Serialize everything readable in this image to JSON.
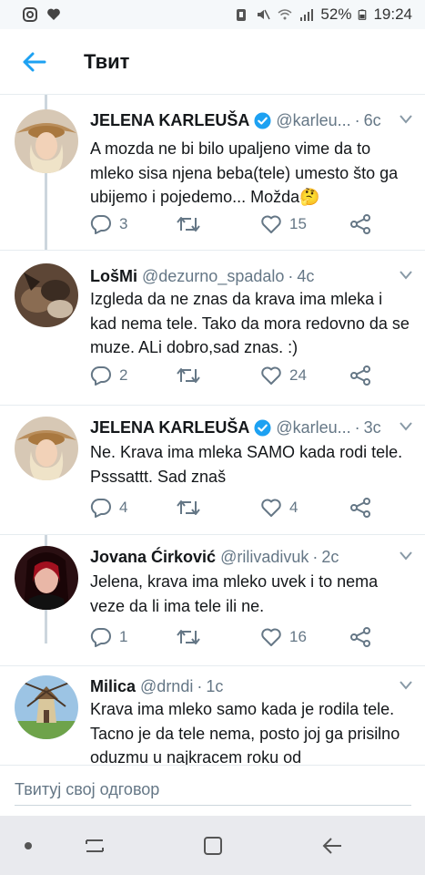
{
  "status_bar": {
    "left_icons": [
      "instagram-icon",
      "heart-icon"
    ],
    "battery": "52%",
    "time": "19:24"
  },
  "header": {
    "title": "Твит",
    "back_icon": "arrow-left-icon"
  },
  "tweets": [
    {
      "name": "JELENA KARLEUŠA",
      "verified": true,
      "handle": "@karleu...",
      "time": "6c",
      "text": "A mozda ne bi bilo upaljeno vime da to mleko sisa njena beba(tele) umesto što ga ubijemo i pojedemo... Možda🤔",
      "replies": "3",
      "retweets": "",
      "likes": "15"
    },
    {
      "name": "LošMi",
      "verified": false,
      "handle": "@dezurno_spadalo",
      "time": "4c",
      "text": "Izgleda da ne znas da krava ima mleka i kad nema tele. Tako da mora redovno da se muze. ALi dobro,sad znas. :)",
      "replies": "2",
      "retweets": "",
      "likes": "24"
    },
    {
      "name": "JELENA KARLEUŠA",
      "verified": true,
      "handle": "@karleu...",
      "time": "3c",
      "text": "Ne. Krava ima mleka SAMO kada rodi tele. Psssattt. Sad znaš",
      "replies": "4",
      "retweets": "",
      "likes": "4"
    },
    {
      "name": "Jovana Ćirković",
      "verified": false,
      "handle": "@rilivadivuk",
      "time": "2c",
      "text": "Jelena, krava ima mleko uvek i to nema veze da li ima tele ili ne.",
      "replies": "1",
      "retweets": "",
      "likes": "16"
    },
    {
      "name": "Milica",
      "verified": false,
      "handle": "@drndi",
      "time": "1c",
      "text": "Krava ima mleko samo kada je rodila tele. Tacno je da tele nema, posto joj ga prisilno oduzmu u najkracem roku od",
      "replies": "",
      "retweets": "",
      "likes": ""
    }
  ],
  "reply_box": {
    "placeholder": "Твитуј свој одговор"
  },
  "colors": {
    "accent": "#1da1f2",
    "secondary_text": "#657786",
    "thread_line": "#ccd6dd",
    "nav_bar": "#e9eaee"
  }
}
